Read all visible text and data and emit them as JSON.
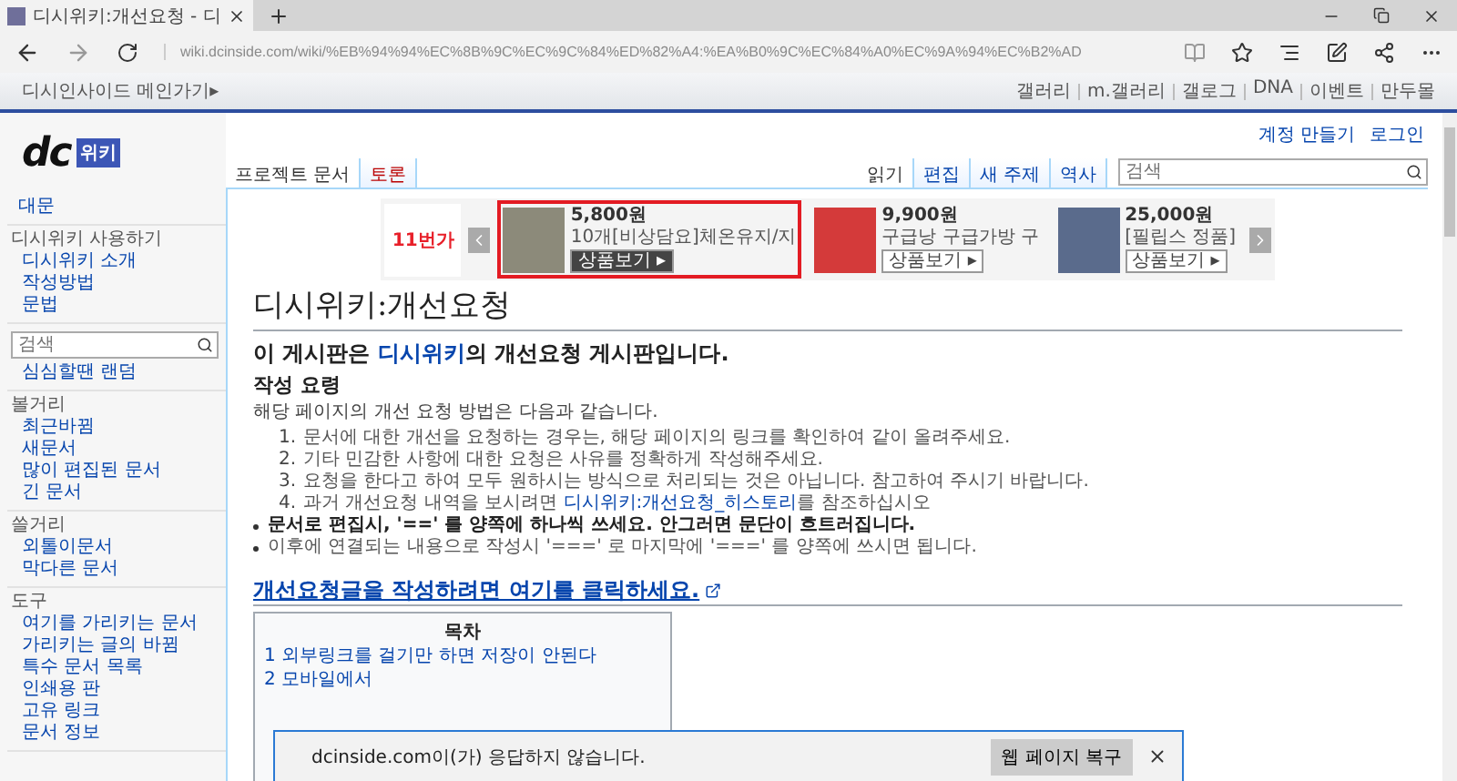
{
  "browser": {
    "tab_title": "디시위키:개선요청 - 디",
    "url": "wiki.dcinside.com/wiki/%EB%94%94%EC%8B%9C%EC%9C%84%ED%82%A4:%EA%B0%9C%EC%84%A0%EC%9A%94%EC%B2%AD"
  },
  "topbar": {
    "main_link": "디시인사이드 메인가기▸",
    "links": [
      "갤러리",
      "m.갤러리",
      "갤로그",
      "DNA",
      "이벤트",
      "만두몰"
    ]
  },
  "logo": {
    "mark": "dc",
    "badge": "위키"
  },
  "personal": [
    "계정 만들기",
    "로그인"
  ],
  "left_tabs": [
    {
      "label": "프로젝트 문서",
      "selected": true,
      "exists": true
    },
    {
      "label": "토론",
      "selected": false,
      "exists": false
    }
  ],
  "right_tabs": [
    {
      "label": "읽기",
      "selected": true
    },
    {
      "label": "편집",
      "selected": false
    },
    {
      "label": "새 주제",
      "selected": false
    },
    {
      "label": "역사",
      "selected": false
    }
  ],
  "search": {
    "placeholder": "검색"
  },
  "sidebar": [
    {
      "kind": "main",
      "items": [
        "대문"
      ]
    },
    {
      "kind": "group",
      "title": "디시위키 사용하기",
      "items": [
        "디시위키 소개",
        "작성방법",
        "문법"
      ]
    },
    {
      "kind": "search",
      "placeholder": "검색",
      "items": [
        "심심할땐 랜덤"
      ]
    },
    {
      "kind": "group",
      "title": "볼거리",
      "items": [
        "최근바뀜",
        "새문서",
        "많이 편집된 문서",
        "긴 문서"
      ]
    },
    {
      "kind": "group",
      "title": "쓸거리",
      "items": [
        "외톨이문서",
        "막다른 문서"
      ]
    },
    {
      "kind": "group",
      "title": "도구",
      "items": [
        "여기를 가리키는 문서",
        "가리키는 글의 바뀜",
        "특수 문서 목록",
        "인쇄용 판",
        "고유 링크",
        "문서 정보"
      ]
    }
  ],
  "ads": {
    "logo": "11번가",
    "products": [
      {
        "price": "5,800원",
        "name": "10개[비상담요]체온유지/지",
        "button": "상품보기 ▸",
        "selected": true
      },
      {
        "price": "9,900원",
        "name": "구급낭 구급가방 구",
        "button": "상품보기 ▸",
        "selected": false
      },
      {
        "price": "25,000원",
        "name": "[필립스 정품]",
        "button": "상품보기 ▸",
        "selected": false
      }
    ]
  },
  "article": {
    "title": "디시위키:개선요청",
    "intro": {
      "before": "이 게시판은 ",
      "link": "디시위키",
      "after": "의 개선요청 게시판입니다."
    },
    "section_title": "작성 요령",
    "lead": "해당 페이지의 개선 요청 방법은 다음과 같습니다.",
    "steps": [
      {
        "number": "1.",
        "text": "문서에 대한 개선을 요청하는 경우는, 해당 페이지의 링크를 확인하여 같이 올려주세요."
      },
      {
        "number": "2.",
        "text": "기타 민감한 사항에 대한 요청은 사유를 정확하게 작성해주세요."
      },
      {
        "number": "3.",
        "text": "요청을 한다고 하여 모두 원하시는 방식으로 처리되는 것은 아닙니다. 참고하여 주시기 바랍니다."
      },
      {
        "number": "4.",
        "text": "과거 개선요청 내역을 보시려면 ",
        "link": "디시위키:개선요청_히스토리",
        "after": "를 참조하십시오"
      }
    ],
    "notes": [
      {
        "text": "문서로 편집시, '==' 를 양쪽에 하나씩 쓰세요. 안그러면 문단이 흐트러집니다.",
        "bold": true
      },
      {
        "text": "이후에 연결되는 내용으로 작성시 '===' 로 마지막에 '===' 를 양쪽에 쓰시면 됩니다.",
        "bold": false
      }
    ],
    "cta": "개선요청글을 작성하려면 여기를 클릭하세요.",
    "toc": {
      "title": "목차",
      "items": [
        "1 외부링크를 걸기만 하면 저장이 안된다",
        "2 모바일에서"
      ]
    }
  },
  "notification": {
    "message": "dcinside.com이(가) 응답하지 않습니다.",
    "button": "웹 페이지 복구"
  }
}
